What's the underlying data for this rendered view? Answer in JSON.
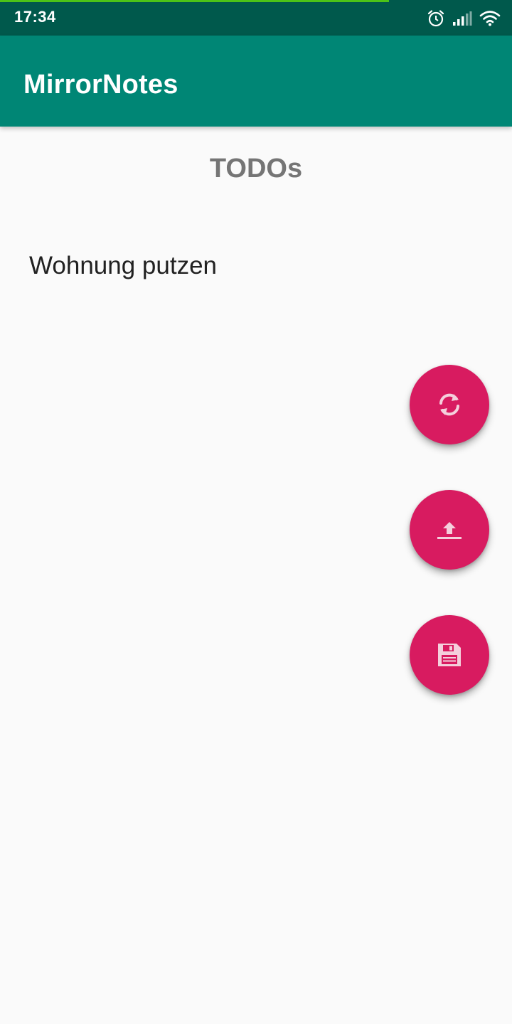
{
  "status_bar": {
    "time": "17:34",
    "icons": [
      "alarm-icon",
      "signal-icon",
      "wifi-icon"
    ],
    "load_progress": 0.76
  },
  "app_bar": {
    "title": "MirrorNotes"
  },
  "main": {
    "section_title": "TODOs",
    "todos": [
      {
        "text": "Wohnung putzen"
      }
    ]
  },
  "fabs": [
    {
      "icon": "sync-icon"
    },
    {
      "icon": "upload-icon"
    },
    {
      "icon": "save-icon"
    }
  ],
  "colors": {
    "status_bar": "#00594c",
    "primary": "#008675",
    "accent": "#d81b60",
    "background": "#fafafa",
    "progress": "#4cc417"
  }
}
